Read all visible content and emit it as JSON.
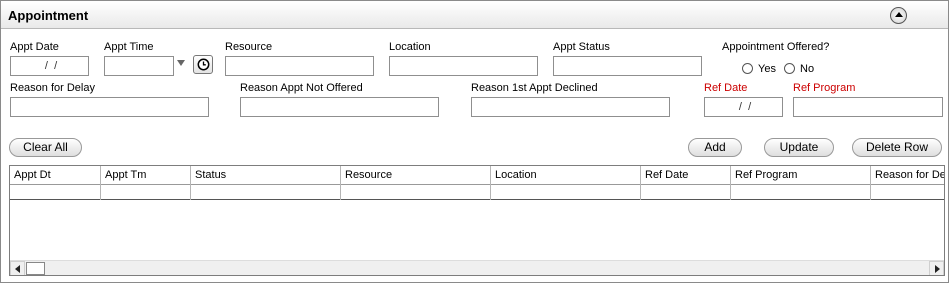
{
  "header": {
    "title": "Appointment"
  },
  "row1": {
    "appt_date": {
      "label": "Appt Date",
      "value": " /  /"
    },
    "appt_time": {
      "label": "Appt Time",
      "value": ""
    },
    "resource": {
      "label": "Resource",
      "value": ""
    },
    "location": {
      "label": "Location",
      "value": ""
    },
    "appt_status": {
      "label": "Appt Status",
      "value": ""
    },
    "offered": {
      "label": "Appointment Offered?",
      "yes": "Yes",
      "no": "No"
    }
  },
  "row2": {
    "reason_delay": {
      "label": "Reason for Delay",
      "value": ""
    },
    "reason_not_offered": {
      "label": "Reason Appt Not Offered",
      "value": ""
    },
    "reason_declined": {
      "label": "Reason 1st Appt Declined",
      "value": ""
    },
    "ref_date": {
      "label": "Ref Date",
      "value": " /  /"
    },
    "ref_program": {
      "label": "Ref Program",
      "value": ""
    }
  },
  "buttons": {
    "clear_all": "Clear All",
    "add": "Add",
    "update": "Update",
    "delete_row": "Delete Row"
  },
  "grid": {
    "columns": [
      "Appt Dt",
      "Appt Tm",
      "Status",
      "Resource",
      "Location",
      "Ref Date",
      "Ref Program",
      "Reason for De"
    ]
  },
  "colors": {
    "required_label": "#cc0000",
    "border": "#8f8f8f"
  }
}
